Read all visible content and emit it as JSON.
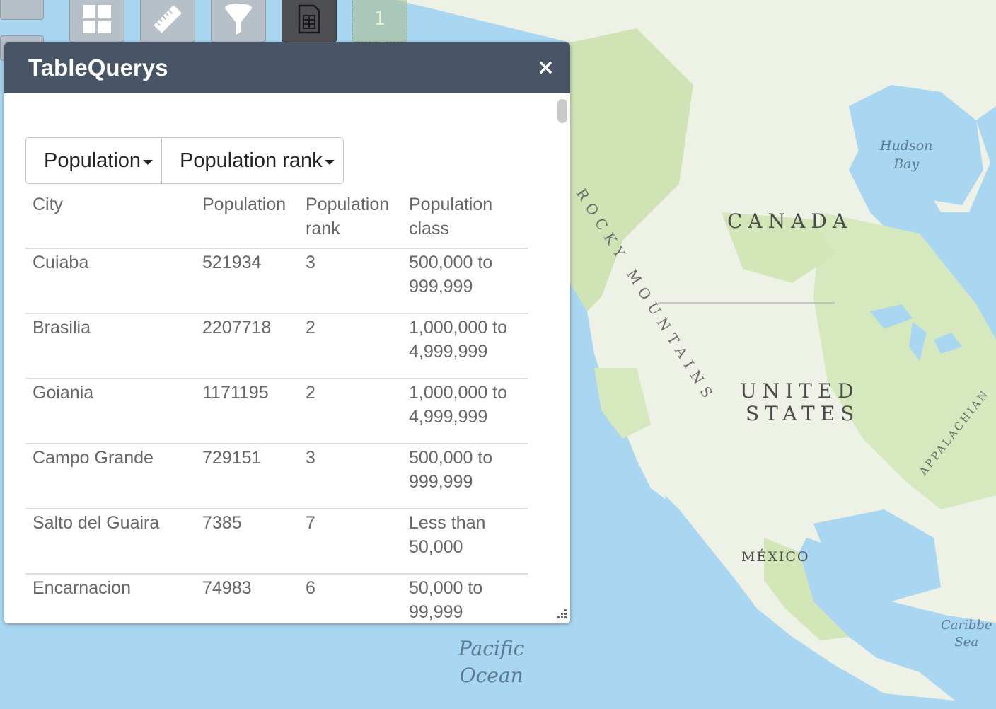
{
  "map": {
    "labels": {
      "canada": "CANADA",
      "united_states_line1": "UNITED",
      "united_states_line2": "STATES",
      "mexico": "MÉXICO",
      "rocky_mountains": "ROCKY MOUNTAINS",
      "appalachian": "APPALACHIAN",
      "hudson_line1": "Hudson",
      "hudson_line2": "Bay",
      "pacific_line1": "Pacific",
      "pacific_line2": "Ocean",
      "caribbean_line1": "Caribbe",
      "caribbean_line2": "Sea"
    },
    "colors": {
      "water": "#a9d6f0",
      "land": "#eef1e6",
      "forest": "#cfe3b5"
    }
  },
  "toolbar": {
    "buttons": [
      {
        "name": "widgets-grid-icon"
      },
      {
        "name": "measure-ruler-icon"
      },
      {
        "name": "filter-funnel-icon"
      },
      {
        "name": "table-spreadsheet-icon"
      }
    ],
    "badge": "1"
  },
  "panel": {
    "title": "TableQuerys",
    "close_icon": "×",
    "colors": {
      "header": "#485566"
    },
    "dropdowns": [
      {
        "label": "Population"
      },
      {
        "label": "Population rank"
      }
    ],
    "table": {
      "headers": [
        "City",
        "Population",
        "Population rank",
        "Population class"
      ],
      "rows": [
        [
          "Cuiaba",
          "521934",
          "3",
          "500,000 to 999,999"
        ],
        [
          "Brasilia",
          "2207718",
          "2",
          "1,000,000 to 4,999,999"
        ],
        [
          "Goiania",
          "1171195",
          "2",
          "1,000,000 to 4,999,999"
        ],
        [
          "Campo Grande",
          "729151",
          "3",
          "500,000 to 999,999"
        ],
        [
          "Salto del Guaira",
          "7385",
          "7",
          "Less than 50,000"
        ],
        [
          "Encarnacion",
          "74983",
          "6",
          "50,000 to 99,999"
        ]
      ]
    }
  }
}
